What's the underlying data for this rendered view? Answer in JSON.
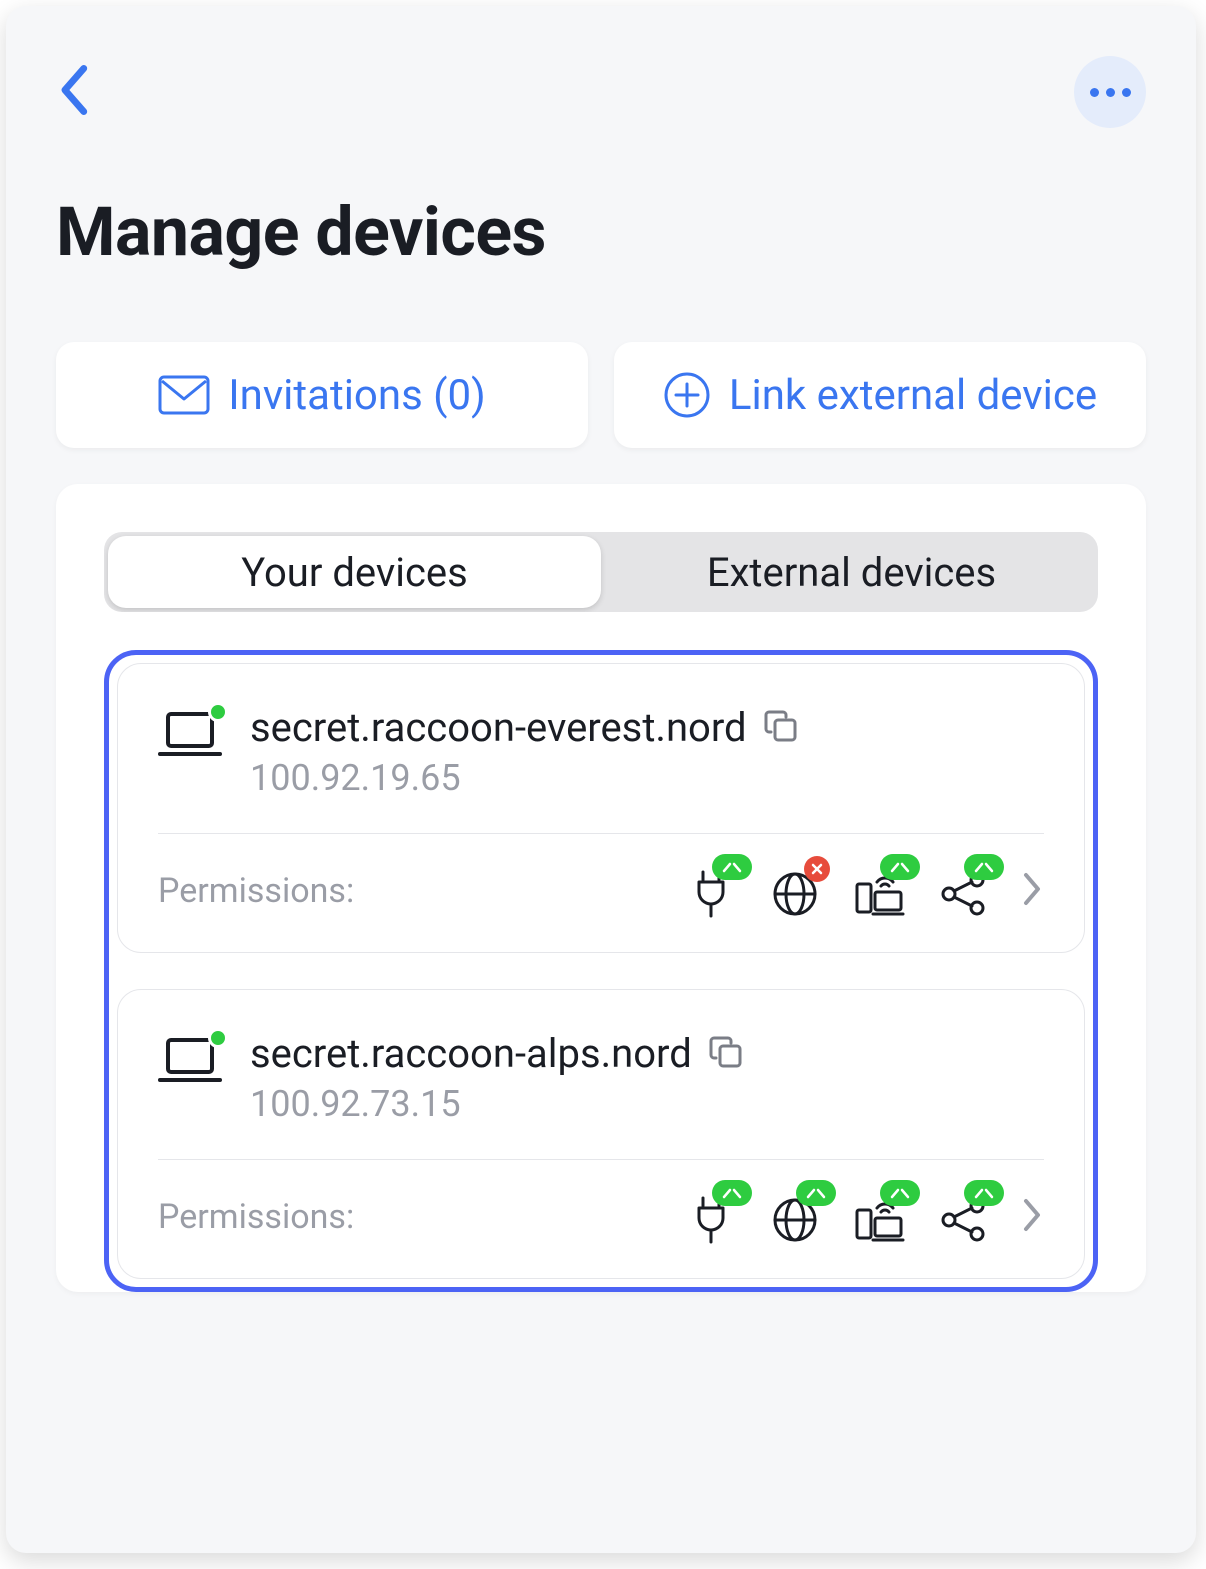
{
  "header": {
    "title": "Manage devices"
  },
  "actions": {
    "invitations_label": "Invitations (0)",
    "link_external_label": "Link external device"
  },
  "tabs": {
    "your_devices": "Your devices",
    "external_devices": "External devices"
  },
  "permissions_label": "Permissions:",
  "devices": [
    {
      "name": "secret.raccoon-everest.nord",
      "ip": "100.92.19.65",
      "online": true,
      "permissions": [
        {
          "icon": "power",
          "status": "green"
        },
        {
          "icon": "globe",
          "status": "red"
        },
        {
          "icon": "devices",
          "status": "green"
        },
        {
          "icon": "share",
          "status": "green"
        }
      ]
    },
    {
      "name": "secret.raccoon-alps.nord",
      "ip": "100.92.73.15",
      "online": true,
      "permissions": [
        {
          "icon": "power",
          "status": "green"
        },
        {
          "icon": "globe",
          "status": "green"
        },
        {
          "icon": "devices",
          "status": "green"
        },
        {
          "icon": "share",
          "status": "green"
        }
      ]
    }
  ],
  "colors": {
    "accent": "#3a76f0",
    "frame": "#4c63f5",
    "success": "#2ecc40",
    "error": "#e74c3c",
    "text": "#1a1d24",
    "muted": "#9a9da6"
  }
}
